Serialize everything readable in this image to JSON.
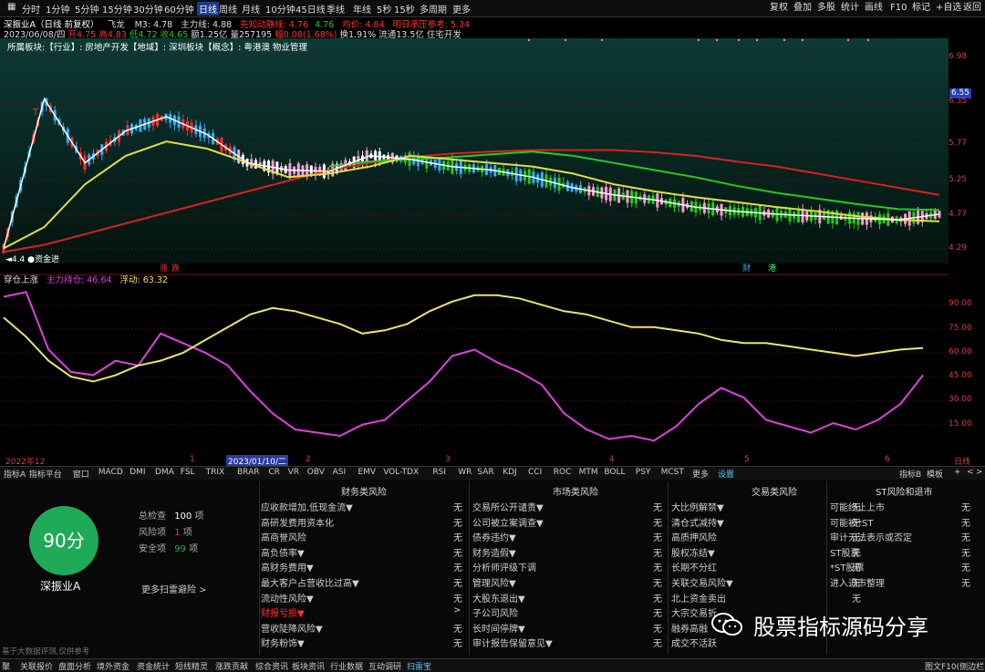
{
  "toolbar": {
    "periods": [
      "分时",
      "1分钟",
      "5分钟",
      "15分钟",
      "30分钟",
      "60分钟",
      "日线",
      "周线",
      "月线",
      "10分钟",
      "45日线",
      "季线",
      "年线",
      "5秒",
      "15秒",
      "多周期",
      "更多"
    ],
    "active_period": "日线",
    "right_buttons": [
      "复权",
      "叠加",
      "多股",
      "统计",
      "画线",
      "F10",
      "标记",
      "+自选",
      "返回"
    ]
  },
  "stock": {
    "title": "深振业A（日线 前复权）",
    "feilong": "飞龙",
    "m3": "M3: 4.78",
    "zhuli": "主力线: 4.88",
    "xianxiang": "先知动静线: 4.76",
    "v1": "4.76",
    "junjia": "均价: 4.84",
    "mingri": "明日承压参考: 5.34",
    "date_line": "2023/06/08/四",
    "open": "开4.75",
    "high": "高4.83",
    "low": "低4.72",
    "close": "收4.65",
    "amount": "额1.25亿",
    "volume": "量257195",
    "change": "幅0.08(1.68%)",
    "turnover": "换1.91%",
    "float": "流通13.5亿",
    "sector": "住宅开发",
    "belong": "所属板块:【行业】: 房地产开发【地域】: 深圳板块【概念】: 粤港澳 物业管理"
  },
  "chart_labels": {
    "t_mark": "T",
    "bottom_left": "◄4.4 ●资金进",
    "red_mark1": "涨",
    "red_mark2": "跌",
    "fin_mark": "财",
    "port_mark": "港",
    "current_price": "6.55"
  },
  "indicator": {
    "name": "穿仓上涨",
    "zhuli_label": "主力持仓: 46.64",
    "fudong_label": "浮动: 63.32"
  },
  "chart_data": [
    {
      "type": "line",
      "title": "深振业A（日线 前复权）",
      "ylim": [
        4.1,
        7.25
      ],
      "y_ticks": [
        6.98,
        6.35,
        5.77,
        5.25,
        4.77,
        4.29
      ],
      "x_ticks": [
        "2022年12",
        "1",
        "2023/01/10/二",
        "2",
        "3",
        "4",
        "5",
        "6",
        "日线"
      ],
      "series": [
        {
          "name": "主力线",
          "color": "#d92020",
          "values": [
            4.25,
            4.35,
            4.5,
            4.65,
            4.8,
            4.95,
            5.1,
            5.25,
            5.4,
            5.5,
            5.58,
            5.63,
            5.66,
            5.68,
            5.68,
            5.68,
            5.65,
            5.6,
            5.52,
            5.45,
            5.35,
            5.25,
            5.15,
            5.05
          ]
        },
        {
          "name": "先知动静线",
          "color": "#22cc22",
          "values": [
            null,
            null,
            null,
            null,
            null,
            null,
            null,
            null,
            5.45,
            5.52,
            5.55,
            5.58,
            5.62,
            5.66,
            5.6,
            5.5,
            5.4,
            5.3,
            5.18,
            5.08,
            5.0,
            4.92,
            4.85,
            4.84
          ]
        },
        {
          "name": "均价",
          "color": "#e0e040",
          "values": [
            4.3,
            4.6,
            5.2,
            5.6,
            5.8,
            5.7,
            5.5,
            5.3,
            5.35,
            5.45,
            5.6,
            5.55,
            5.5,
            5.45,
            5.35,
            5.2,
            5.1,
            5.02,
            4.95,
            4.88,
            4.82,
            4.75,
            4.7,
            4.68
          ]
        },
        {
          "name": "M3",
          "color": "#ffffff",
          "values": [
            4.3,
            6.4,
            5.5,
            5.95,
            6.15,
            5.9,
            5.5,
            5.4,
            5.38,
            5.6,
            5.55,
            5.45,
            5.4,
            5.3,
            5.15,
            5.05,
            4.98,
            4.88,
            4.82,
            4.78,
            4.75,
            4.72,
            4.7,
            4.78
          ]
        }
      ]
    },
    {
      "type": "line",
      "title": "穿仓上涨",
      "ylim": [
        0,
        105
      ],
      "y_ticks": [
        90.0,
        75.0,
        60.0,
        45.0,
        30.0,
        15.0
      ],
      "series": [
        {
          "name": "主力持仓",
          "color": "#e040e0",
          "values": [
            95,
            98,
            62,
            48,
            46,
            55,
            52,
            72,
            66,
            60,
            52,
            36,
            22,
            12,
            10,
            8,
            15,
            18,
            30,
            42,
            58,
            62,
            54,
            48,
            40,
            22,
            12,
            6,
            8,
            5,
            14,
            28,
            38,
            32,
            18,
            14,
            10,
            16,
            12,
            18,
            28,
            46
          ]
        },
        {
          "name": "浮动",
          "color": "#e8e860",
          "values": [
            82,
            70,
            55,
            45,
            42,
            46,
            52,
            55,
            60,
            68,
            76,
            84,
            88,
            86,
            82,
            78,
            72,
            74,
            78,
            86,
            92,
            96,
            96,
            94,
            90,
            86,
            84,
            80,
            76,
            76,
            74,
            72,
            68,
            66,
            66,
            64,
            62,
            60,
            58,
            60,
            62,
            63
          ]
        }
      ]
    }
  ],
  "tabs": [
    "指标A",
    "指标平台",
    "窗口",
    "MACD",
    "DMI",
    "DMA",
    "FSL",
    "TRIX",
    "BRAR",
    "CR",
    "VR",
    "OBV",
    "ASI",
    "EMV",
    "VOL-TDX",
    "RSI",
    "WR",
    "SAR",
    "KDJ",
    "CCI",
    "ROC",
    "MTM",
    "BOLL",
    "PSY",
    "MCST",
    "更多",
    "设置"
  ],
  "tabs_right": [
    "指标B",
    "模板",
    "+",
    "<",
    ">"
  ],
  "risk": {
    "score": "90分",
    "stock_name": "深振业A",
    "total_label": "总检查",
    "total_value": "100",
    "total_unit": "项",
    "risk_label": "风险项",
    "risk_value": "1",
    "risk_unit": "项",
    "safe_label": "安全项",
    "safe_value": "99",
    "safe_unit": "项",
    "more_link": "更多扫雷避险 >",
    "col1": {
      "title": "财务类风险",
      "rows": [
        {
          "label": "应收款增加,低现金流▼",
          "value": "无"
        },
        {
          "label": "高研发费用资本化",
          "value": "无"
        },
        {
          "label": "高商誉风险",
          "value": "无"
        },
        {
          "label": "高负债率▼",
          "value": "无"
        },
        {
          "label": "高财务费用▼",
          "value": "无"
        },
        {
          "label": "最大客户占营收比过高▼",
          "value": "无"
        },
        {
          "label": "流动性风险▼",
          "value": "无"
        },
        {
          "label": "财报亏损▼",
          "value": ">"
        },
        {
          "label": "营收陡降风险▼",
          "value": "无"
        },
        {
          "label": "财务粉饰▼",
          "value": "无"
        }
      ]
    },
    "col2": {
      "title": "市场类风险",
      "rows": [
        {
          "label": "交易所公开谴责▼",
          "value": "无"
        },
        {
          "label": "公司被立案调查▼",
          "value": "无"
        },
        {
          "label": "债券违约▼",
          "value": "无"
        },
        {
          "label": "财务造假▼",
          "value": "无"
        },
        {
          "label": "分析师评级下调",
          "value": "无"
        },
        {
          "label": "管理风险▼",
          "value": "无"
        },
        {
          "label": "大股东退出▼",
          "value": "无"
        },
        {
          "label": "子公司风险",
          "value": "无"
        },
        {
          "label": "长时间停牌▼",
          "value": "无"
        },
        {
          "label": "审计报告保留意见▼",
          "value": "无"
        }
      ]
    },
    "col3": {
      "title": "交易类风险",
      "rows": [
        {
          "label": "大比例解禁▼",
          "value": "无"
        },
        {
          "label": "清仓式减持▼",
          "value": "无"
        },
        {
          "label": "高质押风险",
          "value": "无"
        },
        {
          "label": "股权冻结▼",
          "value": "无"
        },
        {
          "label": "长期不分红",
          "value": "无"
        },
        {
          "label": "关联交易风险▼",
          "value": "无"
        },
        {
          "label": "北上资金卖出",
          "value": "无"
        },
        {
          "label": "大宗交易折",
          "value": ""
        },
        {
          "label": "融券高融",
          "value": ""
        },
        {
          "label": "成交不活跃",
          "value": ""
        }
      ]
    },
    "col4": {
      "title": "ST风险和退市",
      "rows": [
        {
          "label": "可能终止上市",
          "value": "无"
        },
        {
          "label": "可能被*ST",
          "value": "无"
        },
        {
          "label": "审计无法表示或否定",
          "value": "无"
        },
        {
          "label": "ST股票",
          "value": "无"
        },
        {
          "label": "*ST股票",
          "value": "无"
        },
        {
          "label": "进入退市整理",
          "value": "无"
        }
      ]
    },
    "disclaimer": "基于大数据评测,仅供参考"
  },
  "watermark": "股票指标源码分享",
  "footer": {
    "items": [
      "聚",
      "关联报价",
      "盘面分析",
      "境外资金",
      "资金统计",
      "短线精灵",
      "涨跌贡献",
      "综合资讯",
      "板块资讯",
      "行业数据",
      "互动调研",
      "扫雷宝"
    ],
    "right": "图文F10(侧边栏)"
  },
  "colors": {
    "up": "#ff3030",
    "down": "#30b0ff",
    "ma_green": "#22cc22",
    "yellow": "#e8e860",
    "magenta": "#e040e0",
    "score": "#1faa57"
  }
}
